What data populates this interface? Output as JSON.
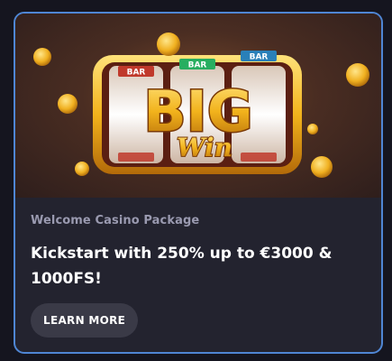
{
  "promo": {
    "category": "Welcome Casino Package",
    "headline": "Kickstart with 250% up to €3000 & 1000FS!",
    "cta_label": "LEARN MORE",
    "banner": {
      "slot_symbol_label": "BAR",
      "title_text": "BIG",
      "subtitle_text": "Win"
    }
  },
  "colors": {
    "card_border": "#4f86d4",
    "card_bg": "#23232f",
    "cta_bg": "#3a3a47",
    "gold": "#f2b31c"
  }
}
